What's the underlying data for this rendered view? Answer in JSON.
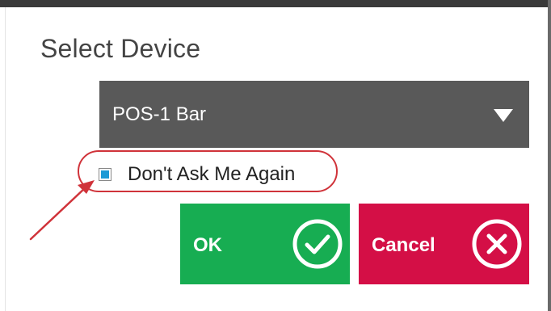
{
  "dialog": {
    "title": "Select Device"
  },
  "device_select": {
    "selected_value": "POS-1 Bar",
    "icon": "dropdown-triangle-icon"
  },
  "dont_ask_again": {
    "label": "Don't Ask Me Again",
    "checked": true,
    "check_color": "#1c9ad6"
  },
  "buttons": {
    "ok": {
      "label": "OK",
      "icon": "checkmark-circle-icon",
      "color": "#17ad52"
    },
    "cancel": {
      "label": "Cancel",
      "icon": "x-circle-icon",
      "color": "#d40f46"
    }
  },
  "annotation": {
    "color": "#d0333a"
  }
}
